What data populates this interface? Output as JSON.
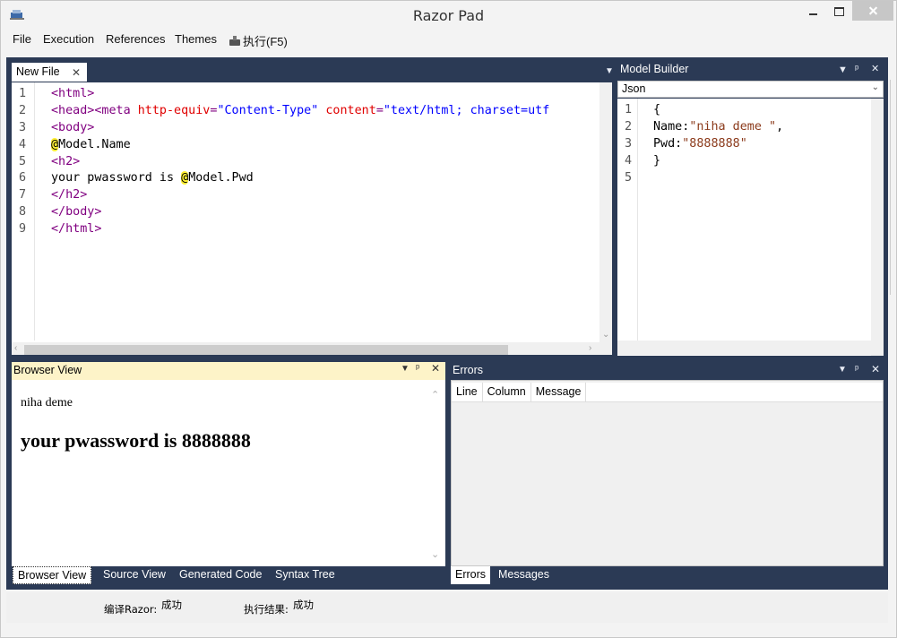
{
  "window": {
    "title": "Razor Pad"
  },
  "menu": {
    "items": [
      "File",
      "Execution",
      "References",
      "Themes"
    ],
    "run": "执行(F5)"
  },
  "editor": {
    "tab": "New File",
    "lines": [
      {
        "n": "1",
        "parts": [
          [
            "tag",
            "<html>"
          ]
        ]
      },
      {
        "n": "2",
        "parts": [
          [
            "tag",
            "<head><meta "
          ],
          [
            "attr",
            "http-equiv"
          ],
          [
            "tag",
            "="
          ],
          [
            "val",
            "\"Content-Type\""
          ],
          [
            "tag",
            " "
          ],
          [
            "attr",
            "content"
          ],
          [
            "tag",
            "="
          ],
          [
            "val",
            "\"text/html; charset=utf"
          ]
        ]
      },
      {
        "n": "3",
        "parts": [
          [
            "tag",
            "<body>"
          ]
        ]
      },
      {
        "n": "4",
        "parts": [
          [
            "at",
            "@"
          ],
          [
            "plain",
            "Model.Name"
          ]
        ]
      },
      {
        "n": "5",
        "parts": [
          [
            "tag",
            "<h2>"
          ]
        ]
      },
      {
        "n": "6",
        "parts": [
          [
            "plain",
            "your pwassword is "
          ],
          [
            "at",
            "@"
          ],
          [
            "plain",
            "Model.Pwd"
          ]
        ]
      },
      {
        "n": "7",
        "parts": [
          [
            "tag",
            "</h2>"
          ]
        ]
      },
      {
        "n": "8",
        "parts": [
          [
            "tag",
            "</body>"
          ]
        ]
      },
      {
        "n": "9",
        "parts": [
          [
            "tag",
            "</html>"
          ]
        ]
      }
    ]
  },
  "model_builder": {
    "title": "Model Builder",
    "format": "Json",
    "lines": [
      {
        "n": "1",
        "parts": [
          [
            "plain",
            "{"
          ]
        ]
      },
      {
        "n": "2",
        "parts": [
          [
            "plain",
            "Name:"
          ],
          [
            "str",
            "\"niha deme \""
          ],
          [
            "plain",
            ","
          ]
        ]
      },
      {
        "n": "3",
        "parts": [
          [
            "plain",
            "Pwd:"
          ],
          [
            "str",
            "\"8888888\""
          ]
        ]
      },
      {
        "n": "4",
        "parts": [
          [
            "plain",
            "}"
          ]
        ]
      },
      {
        "n": "5",
        "parts": []
      }
    ]
  },
  "browser": {
    "title": "Browser View",
    "name": "niha deme",
    "heading": "your pwassword is 8888888",
    "tabs": [
      "Browser View",
      "Source View",
      "Generated Code",
      "Syntax Tree"
    ]
  },
  "errors": {
    "title": "Errors",
    "columns": [
      "Line",
      "Column",
      "Message"
    ],
    "tabs": [
      "Errors",
      "Messages"
    ]
  },
  "status": {
    "compile_label": "编译Razor:",
    "compile_value": "成功",
    "run_label": "执行结果:",
    "run_value": "成功"
  },
  "colors": {
    "dock": "#2b3a55",
    "tag": "#800080",
    "attr": "#e00000",
    "value": "#0000ff",
    "highlight": "#ffee33"
  }
}
